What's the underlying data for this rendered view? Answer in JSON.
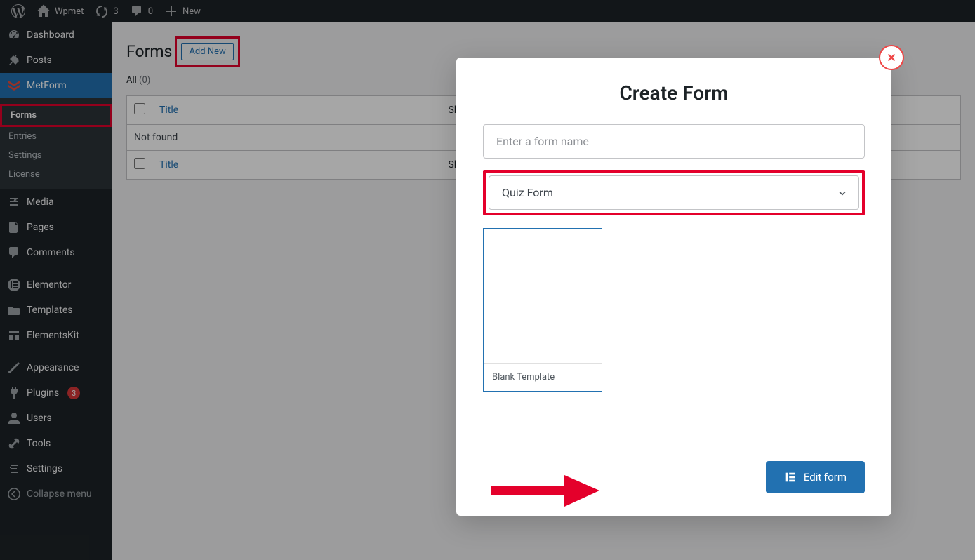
{
  "adminBar": {
    "siteName": "Wpmet",
    "updateCount": "3",
    "commentCount": "0",
    "newLabel": "New"
  },
  "sidebar": {
    "dashboard": "Dashboard",
    "posts": "Posts",
    "metform": "MetForm",
    "sub": {
      "forms": "Forms",
      "entries": "Entries",
      "settings": "Settings",
      "license": "License"
    },
    "media": "Media",
    "pages": "Pages",
    "comments": "Comments",
    "elementor": "Elementor",
    "templates": "Templates",
    "elementsKit": "ElementsKit",
    "appearance": "Appearance",
    "plugins": "Plugins",
    "pluginsBadge": "3",
    "users": "Users",
    "tools": "Tools",
    "settingsMain": "Settings",
    "collapse": "Collapse menu"
  },
  "page": {
    "title": "Forms",
    "addNew": "Add New",
    "filterAll": "All",
    "filterCount": "(0)",
    "colTitle": "Title",
    "colShortcode": "Shortcode",
    "notFound": "Not found"
  },
  "modal": {
    "title": "Create Form",
    "namePlaceholder": "Enter a form name",
    "select": "Quiz Form",
    "templateLabel": "Blank Template",
    "editBtn": "Edit form"
  }
}
